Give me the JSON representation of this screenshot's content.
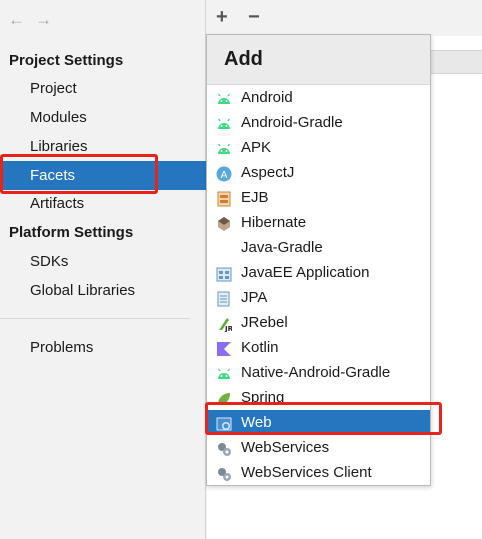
{
  "toolbar": {
    "back_glyph": "←",
    "forward_glyph": "→",
    "add_glyph": "+",
    "remove_glyph": "−"
  },
  "sidebar": {
    "project_settings_title": "Project Settings",
    "project_items": [
      "Project",
      "Modules",
      "Libraries",
      "Facets",
      "Artifacts"
    ],
    "platform_settings_title": "Platform Settings",
    "platform_items": [
      "SDKs",
      "Global Libraries"
    ],
    "problems": "Problems",
    "selected": "Facets"
  },
  "popup": {
    "title": "Add",
    "items": [
      {
        "label": "Android",
        "icon": "android-icon"
      },
      {
        "label": "Android-Gradle",
        "icon": "android-icon"
      },
      {
        "label": "APK",
        "icon": "android-icon"
      },
      {
        "label": "AspectJ",
        "icon": "aspectj-icon"
      },
      {
        "label": "EJB",
        "icon": "ejb-icon"
      },
      {
        "label": "Hibernate",
        "icon": "hibernate-icon"
      },
      {
        "label": "Java-Gradle",
        "icon": ""
      },
      {
        "label": "JavaEE Application",
        "icon": "javaee-icon"
      },
      {
        "label": "JPA",
        "icon": "jpa-icon"
      },
      {
        "label": "JRebel",
        "icon": "jrebel-icon"
      },
      {
        "label": "Kotlin",
        "icon": "kotlin-icon"
      },
      {
        "label": "Native-Android-Gradle",
        "icon": "android-icon"
      },
      {
        "label": "Spring",
        "icon": "spring-icon"
      },
      {
        "label": "Web",
        "icon": "web-icon"
      },
      {
        "label": "WebServices",
        "icon": "webservices-icon"
      },
      {
        "label": "WebServices Client",
        "icon": "webservices-client-icon"
      }
    ],
    "selected": "Web"
  },
  "colors": {
    "selection": "#2675bf",
    "highlight": "#e8241a",
    "android": "#3ddc84"
  }
}
